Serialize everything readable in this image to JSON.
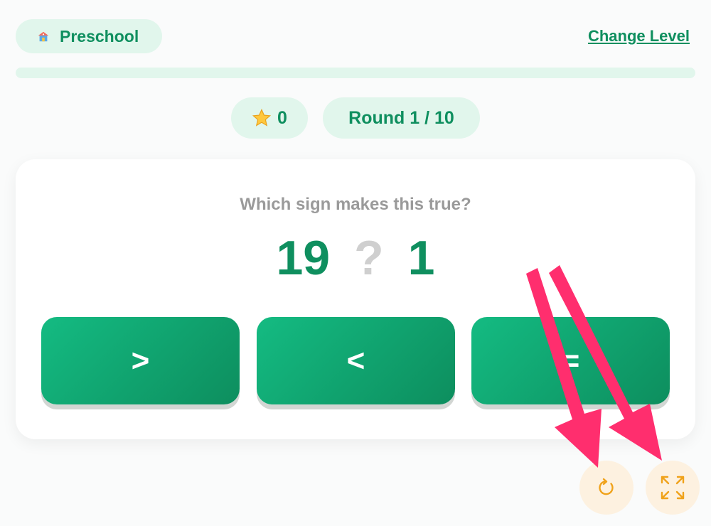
{
  "header": {
    "level_label": "Preschool",
    "change_level_label": "Change Level"
  },
  "progress": {
    "value": 0
  },
  "stats": {
    "stars": "0",
    "round": "Round 1 / 10"
  },
  "question": {
    "prompt": "Which sign makes this true?",
    "left": "19",
    "placeholder": "?",
    "right": "1"
  },
  "answers": {
    "greater": ">",
    "less": "<",
    "equal": "="
  },
  "icons": {
    "level": "school-icon",
    "stars": "star-icon",
    "restart": "restart-icon",
    "fullscreen": "fullscreen-icon"
  },
  "colors": {
    "brand": "#0f8f5f",
    "button_start": "#14bb82",
    "button_end": "#0d8e5e",
    "pill_bg": "#e1f6ec",
    "control_bg": "#fdf1e0",
    "control_icon": "#f0a21a",
    "annotation_arrow": "#ff2e6e"
  }
}
